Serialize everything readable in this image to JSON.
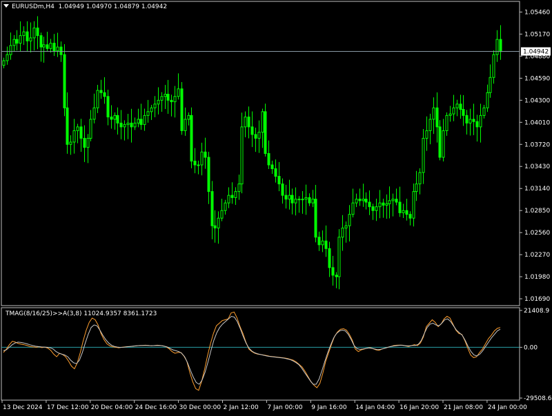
{
  "header": {
    "symbol": "EURUSDm,H4",
    "ohlc": "1.04949 1.04970 1.04879 1.04942"
  },
  "indicator": {
    "label": "TMAG(8/16/25)>>A(3,8) 11024.9357 8361.1723"
  },
  "colors": {
    "background": "#000000",
    "grid_frame": "#c0c0c0",
    "candle": "#00ff00",
    "price_line": "#8a9aa6",
    "price_tag_bg": "#ffffff",
    "indicator_fast": "#ff9f2f",
    "indicator_slow": "#c8c8c8",
    "zero_line": "#2aa0a8"
  },
  "chart_data": [
    {
      "type": "candlestick",
      "panel": "main",
      "ylim": [
        1.016,
        1.056
      ],
      "y_ticks": [
        "1.05460",
        "1.05170",
        "1.04880",
        "1.04590",
        "1.04300",
        "1.04010",
        "1.03720",
        "1.03430",
        "1.03140",
        "1.02850",
        "1.02560",
        "1.02270",
        "1.01980",
        "1.01690"
      ],
      "last_price": 1.04942,
      "last_price_label": "1.04942",
      "x_ticks": [
        "13 Dec 2024",
        "17 Dec 12:00",
        "20 Dec 04:00",
        "24 Dec 16:00",
        "30 Dec 00:00",
        "2 Jan 12:00",
        "7 Jan 00:00",
        "9 Jan 16:00",
        "14 Jan 04:00",
        "16 Jan 20:00",
        "21 Jan 08:00",
        "24 Jan 00:00"
      ],
      "close": [
        1.0482,
        1.049,
        1.0502,
        1.051,
        1.0505,
        1.0515,
        1.052,
        1.0508,
        1.0512,
        1.0525,
        1.0515,
        1.05,
        1.0503,
        1.0498,
        1.0505,
        1.0495,
        1.05,
        1.049,
        1.042,
        1.0372,
        1.0375,
        1.039,
        1.0395,
        1.038,
        1.0368,
        1.038,
        1.0405,
        1.042,
        1.0443,
        1.044,
        1.0435,
        1.0408,
        1.0405,
        1.041,
        1.04,
        1.0395,
        1.0398,
        1.04,
        1.0395,
        1.04,
        1.0405,
        1.0398,
        1.041,
        1.0415,
        1.042,
        1.0425,
        1.043,
        1.0435,
        1.0438,
        1.043,
        1.0428,
        1.0435,
        1.0445,
        1.039,
        1.0405,
        1.041,
        1.035,
        1.0345,
        1.0345,
        1.0362,
        1.0355,
        1.031,
        1.0265,
        1.0262,
        1.0275,
        1.0285,
        1.0295,
        1.0305,
        1.0302,
        1.031,
        1.032,
        1.0395,
        1.0408,
        1.0395,
        1.0385,
        1.038,
        1.0388,
        1.0415,
        1.036,
        1.0345,
        1.034,
        1.033,
        1.032,
        1.0305,
        1.03,
        1.0305,
        1.0295,
        1.03,
        1.03,
        1.03,
        1.0302,
        1.0295,
        1.03,
        1.025,
        1.024,
        1.0245,
        1.0235,
        1.021,
        1.02,
        1.0198,
        1.025,
        1.0262,
        1.0265,
        1.028,
        1.0295,
        1.03,
        1.0298,
        1.03,
        1.0296,
        1.029,
        1.0285,
        1.029,
        1.0295,
        1.0292,
        1.0294,
        1.0298,
        1.03,
        1.0296,
        1.0282,
        1.0285,
        1.028,
        1.0275,
        1.031,
        1.032,
        1.0335,
        1.038,
        1.039,
        1.0405,
        1.042,
        1.0395,
        1.0355,
        1.039,
        1.041,
        1.0412,
        1.042,
        1.0425,
        1.0418,
        1.041,
        1.04,
        1.0405,
        1.0402,
        1.0395,
        1.041,
        1.042,
        1.044,
        1.046,
        1.049,
        1.051,
        1.0494
      ]
    },
    {
      "type": "line",
      "panel": "indicator",
      "title": "TMAG(8/16/25)>>A(3,8)",
      "ylim": [
        -29508.6,
        21408.9
      ],
      "y_ticks": [
        "21408.9",
        "0.00",
        "-29508.6"
      ],
      "zero_line": 0.0,
      "series": [
        {
          "values": [
            -3000,
            -1000,
            1500,
            3500,
            3000,
            2200,
            1800,
            1500,
            1000,
            500,
            200,
            0,
            300,
            -200,
            100,
            -500,
            -1800,
            -4000,
            -5500,
            -3500,
            -4200,
            -5500,
            -8000,
            -11000,
            -12500,
            -9000,
            -3000,
            4000,
            10000,
            14500,
            17000,
            16000,
            13000,
            8000,
            4500,
            2000,
            800,
            300,
            0,
            -300,
            0,
            200,
            400,
            500,
            700,
            900,
            1000,
            1100,
            1200,
            1100,
            900,
            1000,
            1200,
            1100,
            800,
            300,
            -800,
            -2500,
            -3500,
            -3000,
            -3000,
            -5000,
            -8000,
            -14500,
            -20000,
            -24000,
            -25000,
            -20000,
            -13000,
            -5000,
            2000,
            8000,
            12500,
            14000,
            15500,
            16000,
            16500,
            20000,
            20500,
            17000,
            12000,
            8000,
            3000,
            -1000,
            -2500,
            -3500,
            -4000,
            -4200,
            -4500,
            -4800,
            -5200,
            -5400,
            -5600,
            -5800,
            -6000,
            -6200,
            -6500,
            -7000,
            -7500,
            -8500,
            -10000,
            -11500,
            -14000,
            -17000,
            -20000,
            -22000,
            -23500,
            -21000,
            -15000,
            -8000,
            -3000,
            2000,
            6500,
            9000,
            10500,
            10800,
            10000,
            7500,
            4000,
            -1000,
            -2500,
            -1500,
            -1000,
            -500,
            -200,
            -800,
            -1500,
            -1800,
            -1000,
            -500,
            0,
            500,
            1000,
            1200,
            1300,
            1200,
            800,
            500,
            1000,
            1500,
            1000,
            2500,
            6000,
            12000,
            14000,
            16000,
            14500,
            12000,
            13500,
            16500,
            18000,
            17000,
            13500,
            10000,
            8000,
            7500,
            4000,
            -500,
            -4500,
            -6000,
            -5500,
            -3000,
            -1000,
            2000,
            5000,
            7000,
            9500,
            11000,
            11500
          ]
        },
        {
          "values": [
            -2000,
            -1500,
            0,
            1500,
            2500,
            3000,
            2800,
            2500,
            2000,
            1500,
            1000,
            600,
            400,
            200,
            100,
            0,
            -300,
            -1000,
            -2500,
            -3500,
            -4000,
            -4500,
            -5500,
            -7500,
            -9000,
            -9500,
            -7500,
            -3000,
            2500,
            7500,
            11500,
            13000,
            12500,
            10000,
            7000,
            4500,
            2500,
            1200,
            500,
            100,
            -100,
            0,
            200,
            400,
            600,
            800,
            950,
            1050,
            1100,
            1100,
            1000,
            950,
            1000,
            1050,
            950,
            700,
            200,
            -600,
            -1500,
            -2000,
            -2500,
            -3500,
            -5500,
            -9000,
            -13500,
            -17500,
            -20500,
            -21500,
            -19000,
            -14500,
            -8500,
            -2000,
            4000,
            8500,
            11500,
            13500,
            15000,
            16500,
            18000,
            17500,
            15000,
            11000,
            6500,
            2500,
            -500,
            -2200,
            -3200,
            -3800,
            -4200,
            -4600,
            -5000,
            -5300,
            -5500,
            -5700,
            -5900,
            -6100,
            -6300,
            -6700,
            -7100,
            -7800,
            -8800,
            -10000,
            -12000,
            -14500,
            -17000,
            -19500,
            -21500,
            -21500,
            -18500,
            -13500,
            -8000,
            -3000,
            1500,
            5500,
            8000,
            9500,
            10000,
            9500,
            7500,
            4500,
            1000,
            -800,
            -1200,
            -1000,
            -700,
            -400,
            -600,
            -1000,
            -1400,
            -1200,
            -800,
            -300,
            200,
            600,
            900,
            1100,
            1200,
            1100,
            900,
            900,
            1100,
            1100,
            1800,
            4000,
            8000,
            11500,
            13500,
            14000,
            13000,
            12500,
            14000,
            16000,
            16500,
            15000,
            12500,
            10000,
            8500,
            7000,
            4000,
            500,
            -2500,
            -4500,
            -5000,
            -4000,
            -2000,
            500,
            3000,
            5500,
            7500,
            9500,
            10500
          ]
        }
      ]
    }
  ]
}
